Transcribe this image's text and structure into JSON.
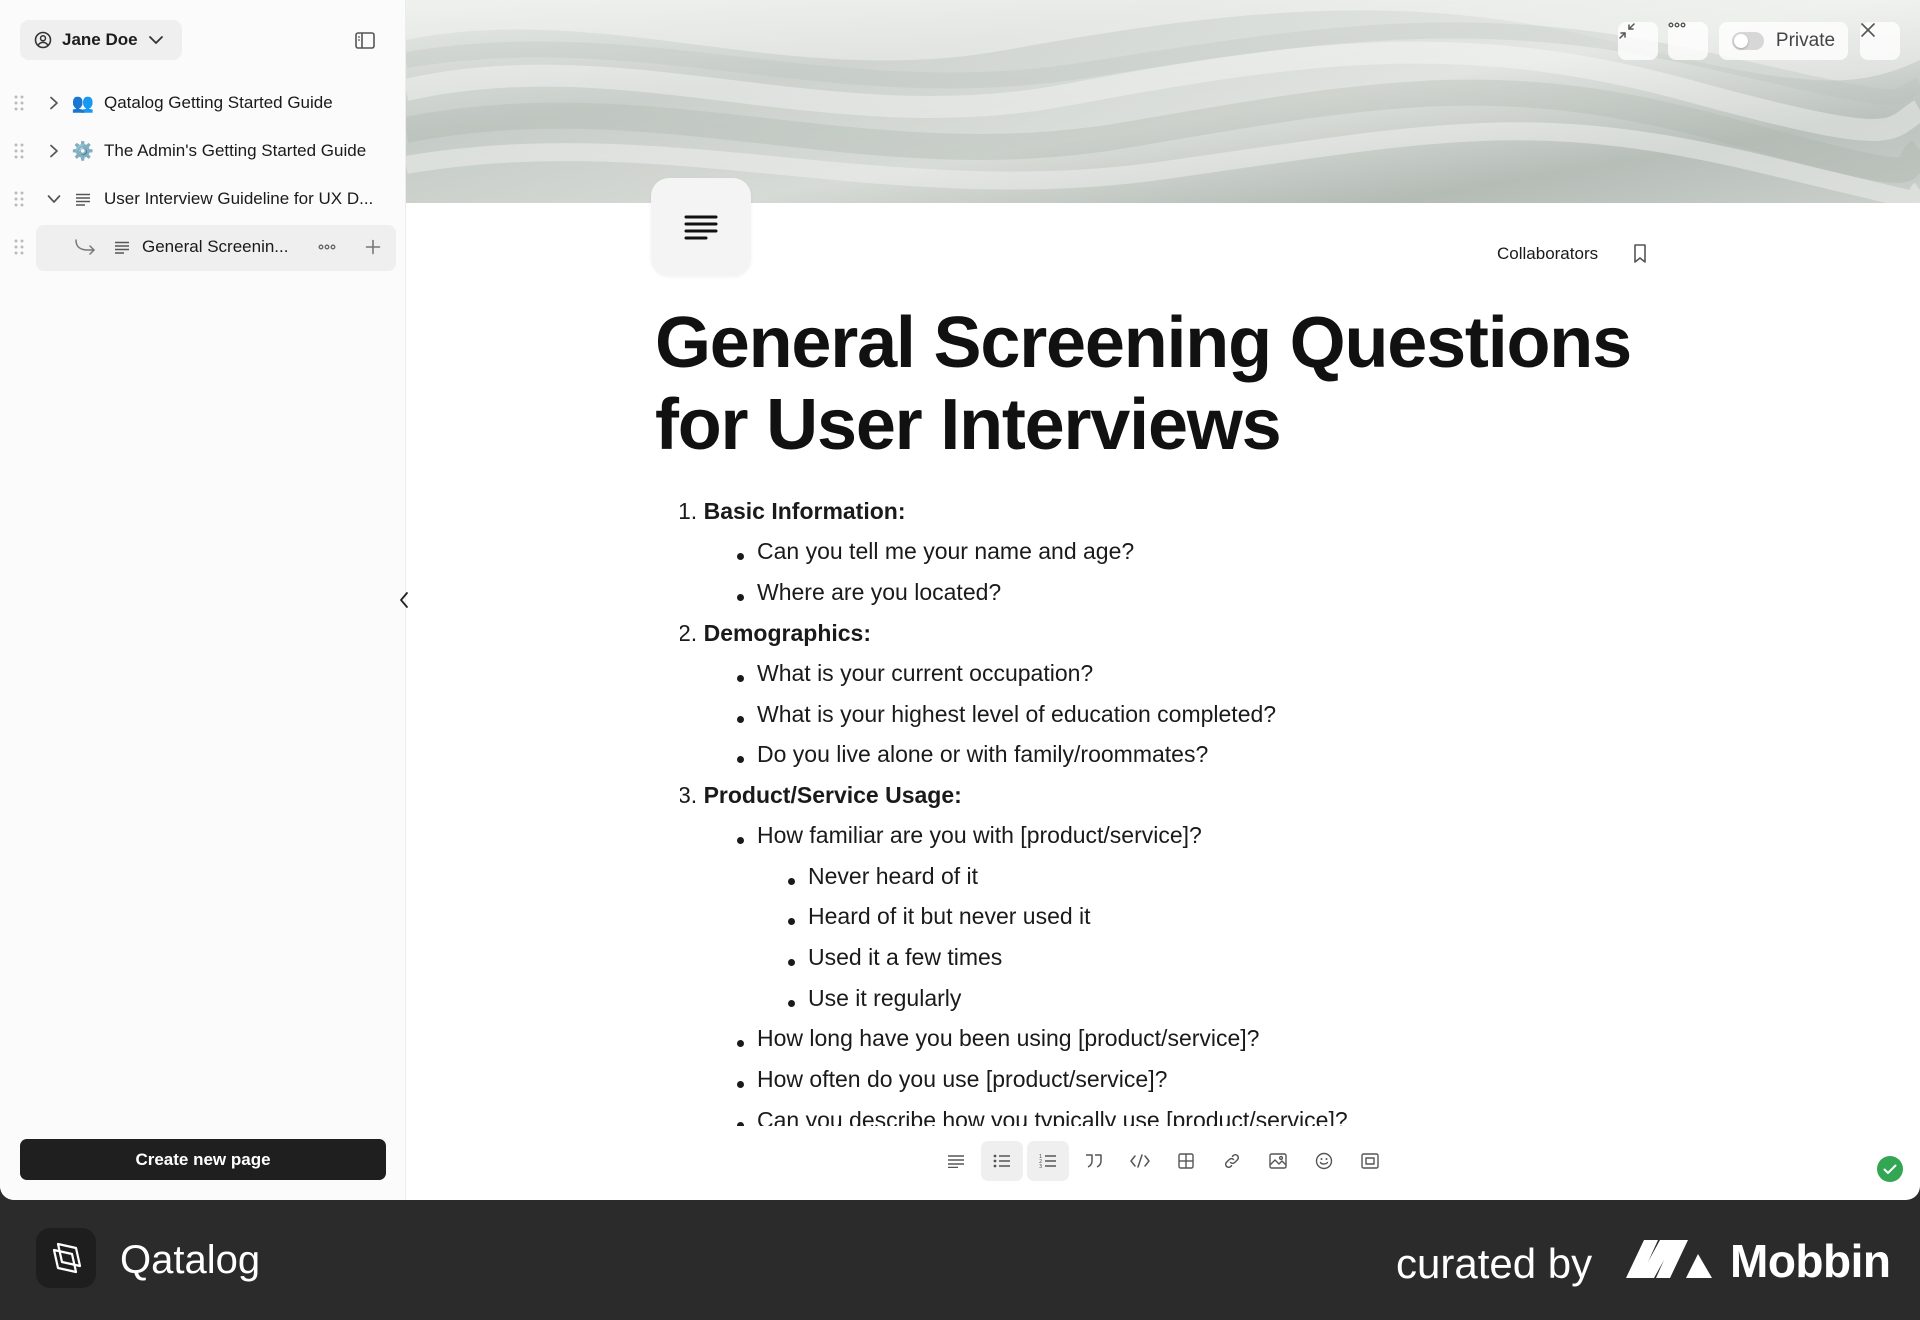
{
  "sidebar": {
    "user": "Jane Doe",
    "items": [
      {
        "label": "Qatalog Getting Started Guide",
        "icon": "people-emoji-icon",
        "emoji": "👥"
      },
      {
        "label": "The Admin's Getting Started Guide",
        "icon": "gear-emoji-icon",
        "emoji": "⚙️"
      },
      {
        "label": "User Interview Guideline for UX D...",
        "icon": "text-lines-icon"
      },
      {
        "label": "General Screenin...",
        "icon": "text-lines-icon"
      }
    ],
    "create_button": "Create new page"
  },
  "header": {
    "privacy_label": "Private",
    "collaborators_label": "Collaborators"
  },
  "document": {
    "title": "General Screening Questions for User Interviews",
    "sections": [
      {
        "number": "1.",
        "heading": "Basic Information:",
        "items": [
          "Can you tell me your name and age?",
          "Where are you located?"
        ]
      },
      {
        "number": "2.",
        "heading": "Demographics:",
        "items": [
          "What is your current occupation?",
          "What is your highest level of education completed?",
          "Do you live alone or with family/roommates?"
        ]
      },
      {
        "number": "3.",
        "heading": "Product/Service Usage:",
        "items": [
          "How familiar are you with [product/service]?",
          "Never heard of it",
          "Heard of it but never used it",
          "Used it a few times",
          "Use it regularly",
          "How long have you been using [product/service]?",
          "How often do you use [product/service]?",
          "Can you describe how you typically use [product/service]?"
        ]
      }
    ]
  },
  "toolbar": {
    "tools": [
      "paragraph-icon",
      "bullet-list-icon",
      "numbered-list-icon",
      "quote-icon",
      "code-icon",
      "table-icon",
      "link-icon",
      "image-icon",
      "emoji-icon",
      "embed-icon"
    ]
  },
  "footer": {
    "brand": "Qatalog",
    "curated_by": "curated by",
    "mobbin": "Mobbin"
  },
  "colors": {
    "primary_button": "#1f1f1f",
    "saved_status": "#33a654",
    "footer_bg": "#2b2b2b"
  }
}
